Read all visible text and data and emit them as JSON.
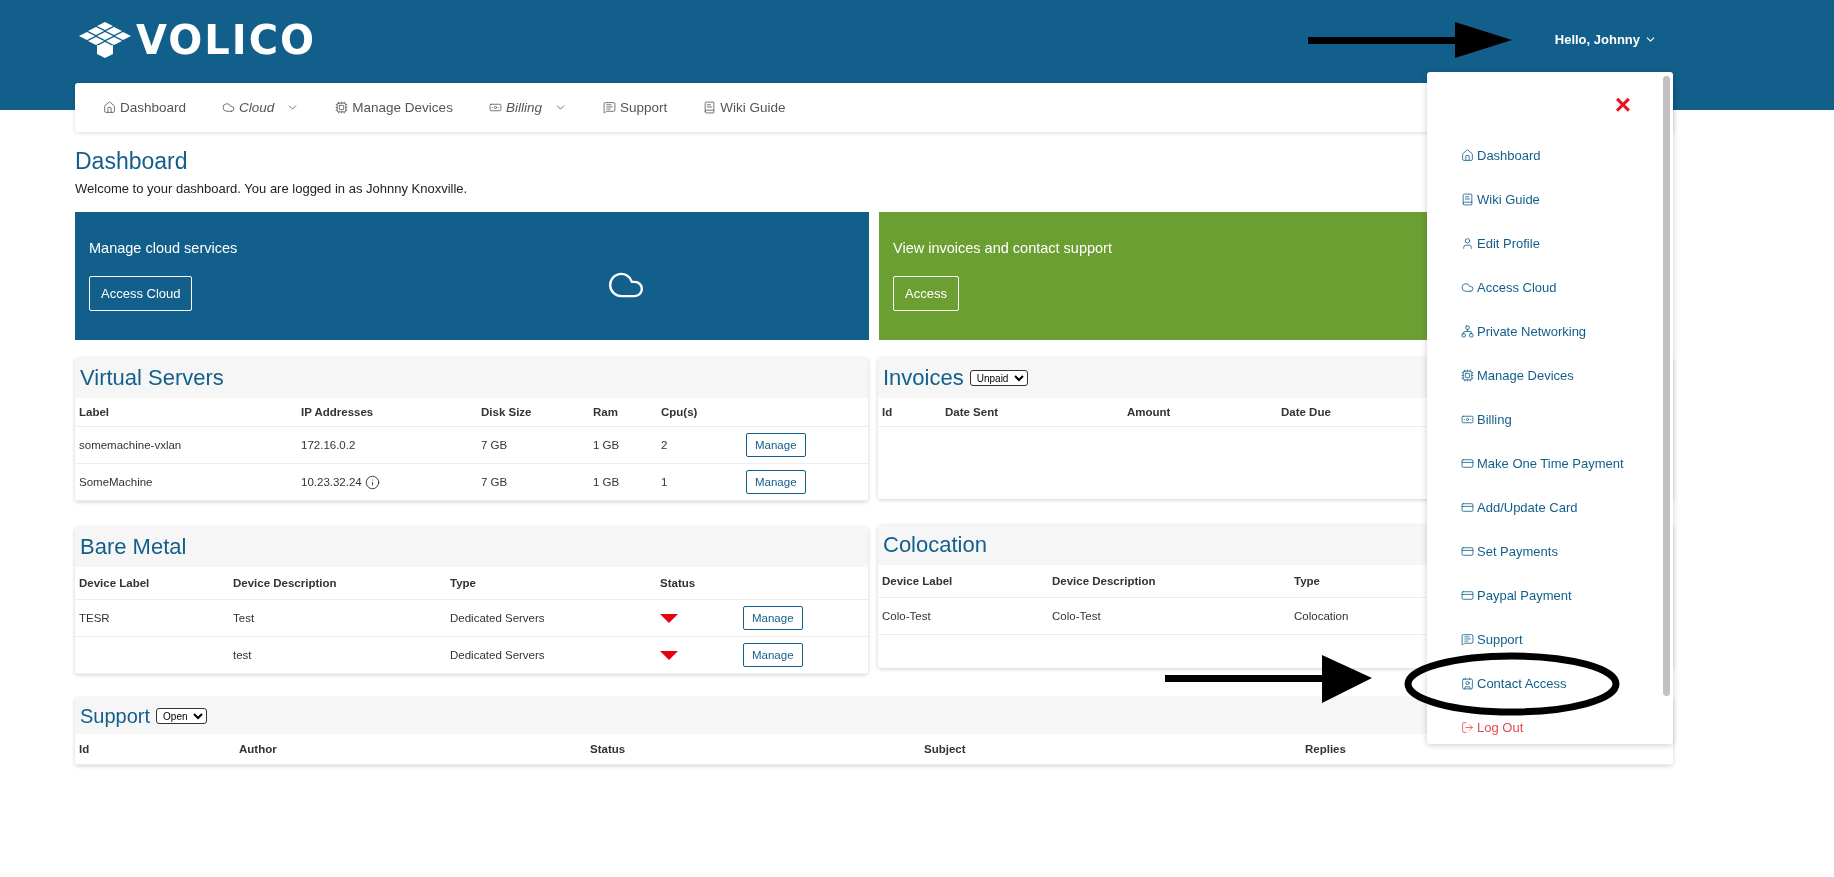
{
  "header": {
    "logo": "VOLICO",
    "greeting": "Hello, Johnny"
  },
  "nav": [
    {
      "label": "Dashboard",
      "dropdown": false
    },
    {
      "label": "Cloud",
      "dropdown": true
    },
    {
      "label": "Manage Devices",
      "dropdown": false
    },
    {
      "label": "Billing",
      "dropdown": true
    },
    {
      "label": "Support",
      "dropdown": false
    },
    {
      "label": "Wiki Guide",
      "dropdown": false
    }
  ],
  "page": {
    "title": "Dashboard",
    "welcome": "Welcome to your dashboard. You are logged in as Johnny Knoxville."
  },
  "cards": [
    {
      "title": "Manage cloud services",
      "button": "Access Cloud",
      "color": "#135f8b",
      "cloud_icon": true
    },
    {
      "title": "View invoices and contact support",
      "button": "Access",
      "color": "#6c9f31",
      "cloud_icon": false
    }
  ],
  "virtual_servers": {
    "title": "Virtual Servers",
    "columns": [
      "Label",
      "IP Addresses",
      "Disk Size",
      "Ram",
      "Cpu(s)"
    ],
    "rows": [
      {
        "cells": [
          "somemachine-vxlan",
          "172.16.0.2",
          "7 GB",
          "1 GB",
          "2"
        ],
        "info": false,
        "action": "Manage"
      },
      {
        "cells": [
          "SomeMachine",
          "10.23.32.24",
          "7 GB",
          "1 GB",
          "1"
        ],
        "info": true,
        "action": "Manage"
      }
    ]
  },
  "invoices": {
    "title": "Invoices",
    "filter": "Unpaid",
    "columns": [
      "Id",
      "Date Sent",
      "Amount",
      "Date Due"
    ]
  },
  "bare_metal": {
    "title": "Bare Metal",
    "columns": [
      "Device Label",
      "Device Description",
      "Type",
      "Status"
    ],
    "rows": [
      {
        "cells": [
          "TESR",
          "Test",
          "Dedicated Servers"
        ],
        "down": true,
        "action": "Manage"
      },
      {
        "cells": [
          "",
          "test",
          "Dedicated Servers"
        ],
        "down": true,
        "action": "Manage"
      }
    ]
  },
  "colocation": {
    "title": "Colocation",
    "columns": [
      "Device Label",
      "Device Description",
      "Type"
    ],
    "rows": [
      {
        "cells": [
          "Colo-Test",
          "Colo-Test",
          "Colocation"
        ]
      }
    ]
  },
  "support": {
    "title": "Support",
    "filter": "Open",
    "columns": [
      "Id",
      "Author",
      "Status",
      "Subject",
      "Replies"
    ]
  },
  "user_menu": {
    "close": "×",
    "items": [
      {
        "label": "Dashboard",
        "kind": "link"
      },
      {
        "label": "Wiki Guide",
        "kind": "link"
      },
      {
        "label": "Edit Profile",
        "kind": "link"
      },
      {
        "label": "Access Cloud",
        "kind": "link"
      },
      {
        "label": "Private Networking",
        "kind": "link"
      },
      {
        "label": "Manage Devices",
        "kind": "link"
      },
      {
        "label": "Billing",
        "kind": "link"
      },
      {
        "label": "Make One Time Payment",
        "kind": "link"
      },
      {
        "label": "Add/Update Card",
        "kind": "link"
      },
      {
        "label": "Set Payments",
        "kind": "link"
      },
      {
        "label": "Paypal Payment",
        "kind": "link"
      },
      {
        "label": "Support",
        "kind": "link"
      },
      {
        "label": "Contact Access",
        "kind": "link"
      },
      {
        "label": "Log Out",
        "kind": "danger"
      }
    ]
  }
}
